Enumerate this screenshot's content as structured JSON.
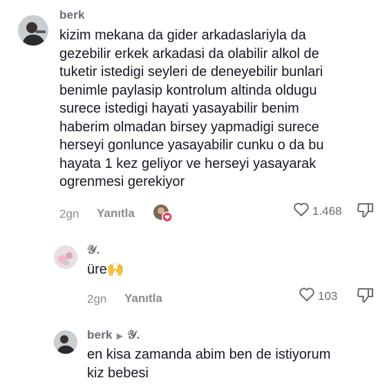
{
  "comments": [
    {
      "username": "berk",
      "text": "kizim mekana da gider arkadaslariyla da\ngezebilir erkek arkadasi da olabilir alkol de\ntuketir istedigi seyleri de deneyebilir bunlari\nbenimle paylasip kontrolum altinda oldugu\nsurece istedigi hayati yasayabilir benim\nhaberim olmadan birsey yapmadigi surece\nherseyi gonlunce yasayabilir cunku o da bu\nhayata 1 kez geliyor ve herseyi yasayarak\nogrenmesi gerekiyor",
      "age": "2gn",
      "reply_label": "Yanıtla",
      "likes": "1.468"
    },
    {
      "username": "𝒴.",
      "text": "üre🙌",
      "age": "2gn",
      "reply_label": "Yanıtla",
      "likes": "103"
    },
    {
      "username": "berk",
      "reply_to": "𝒴.",
      "text": "en kisa zamanda abim ben de istiyorum\nkiz bebesi"
    }
  ],
  "colors": {
    "text": "#161823",
    "muted": "#8a8b91",
    "heart_badge": "#fe2c55"
  }
}
